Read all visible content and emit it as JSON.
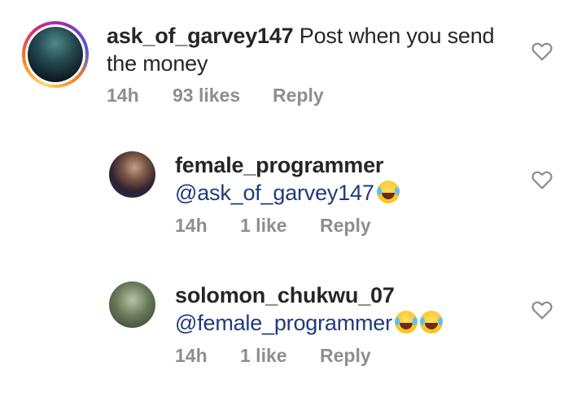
{
  "comments": [
    {
      "username": "ask_of_garvey147",
      "text_line1": "Post when you send",
      "text_line2": "the money",
      "time": "14h",
      "likes": "93 likes",
      "reply": "Reply"
    },
    {
      "username": "female_programmer",
      "mention": "@ask_of_garvey147",
      "emoji": "face-with-tears-of-joy",
      "time": "14h",
      "likes": "1 like",
      "reply": "Reply"
    },
    {
      "username": "solomon_chukwu_07",
      "mention": "@female_programmer",
      "emoji": "face-with-tears-of-joy x2",
      "time": "14h",
      "likes": "1 like",
      "reply": "Reply"
    }
  ],
  "colors": {
    "text": "#262626",
    "meta": "#8e8e8e",
    "mention": "#1f3b7a"
  }
}
